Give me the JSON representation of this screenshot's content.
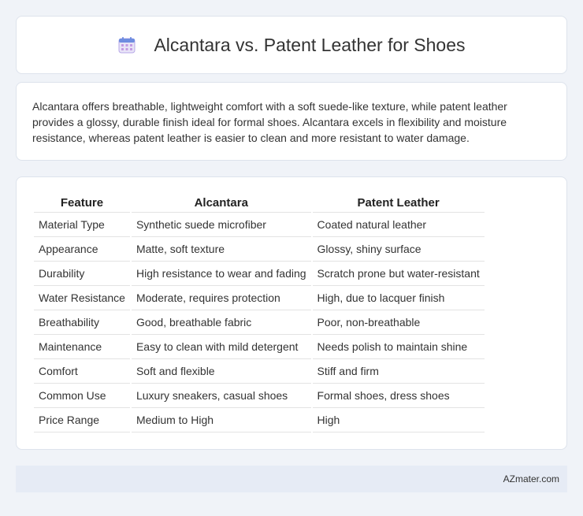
{
  "header": {
    "title": "Alcantara vs. Patent Leather for Shoes",
    "icon": "calendar-icon"
  },
  "intro": {
    "text": "Alcantara offers breathable, lightweight comfort with a soft suede-like texture, while patent leather provides a glossy, durable finish ideal for formal shoes. Alcantara excels in flexibility and moisture resistance, whereas patent leather is easier to clean and more resistant to water damage."
  },
  "table": {
    "headers": [
      "Feature",
      "Alcantara",
      "Patent Leather"
    ],
    "rows": [
      [
        "Material Type",
        "Synthetic suede microfiber",
        "Coated natural leather"
      ],
      [
        "Appearance",
        "Matte, soft texture",
        "Glossy, shiny surface"
      ],
      [
        "Durability",
        "High resistance to wear and fading",
        "Scratch prone but water-resistant"
      ],
      [
        "Water Resistance",
        "Moderate, requires protection",
        "High, due to lacquer finish"
      ],
      [
        "Breathability",
        "Good, breathable fabric",
        "Poor, non-breathable"
      ],
      [
        "Maintenance",
        "Easy to clean with mild detergent",
        "Needs polish to maintain shine"
      ],
      [
        "Comfort",
        "Soft and flexible",
        "Stiff and firm"
      ],
      [
        "Common Use",
        "Luxury sneakers, casual shoes",
        "Formal shoes, dress shoes"
      ],
      [
        "Price Range",
        "Medium to High",
        "High"
      ]
    ]
  },
  "footer": {
    "text": "AZmater.com"
  }
}
